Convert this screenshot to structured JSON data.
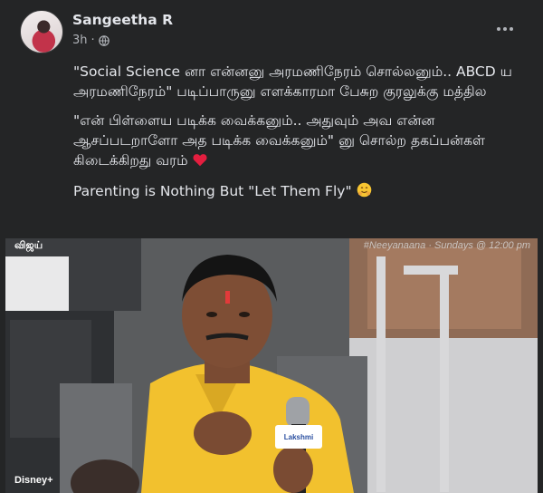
{
  "post": {
    "author": "Sangeetha R",
    "time": "3h",
    "privacy_icon": "globe-icon",
    "more_icon": "more-options-icon",
    "paragraphs": [
      "\"Social Science னா என்னனு அரமணிநேரம் சொல்லனும்.. ABCD ய அரமணிநேரம்\" படிப்பாருனு எளக்காரமா பேசுற குரலுக்கு மத்தில",
      "\"என் பிள்ளைய படிக்க வைக்கனும்.. அதுவும் அவ என்ன ஆசப்படறாளோ அத படிக்க வைக்கனும்\" னு சொல்ற தகப்பன்கள் கிடைக்கிறது வரம்"
    ],
    "paragraph2_icon": "red-heart-icon",
    "english_line": "Parenting is Nothing But \"Let Them Fly\"",
    "english_line_icon": "hugging-face-icon"
  },
  "photo": {
    "watermark": "#Neeyanaana · Sundays @ 12:00 pm",
    "mic_brand": "Lakshmi",
    "channel_logo": "விஜய்",
    "streaming_logo": "Disney+"
  },
  "colors": {
    "background": "#242526",
    "text_primary": "#e4e6eb",
    "text_secondary": "#b0b3b8",
    "heart": "#e41e3f",
    "shirt": "#f2c12e"
  }
}
